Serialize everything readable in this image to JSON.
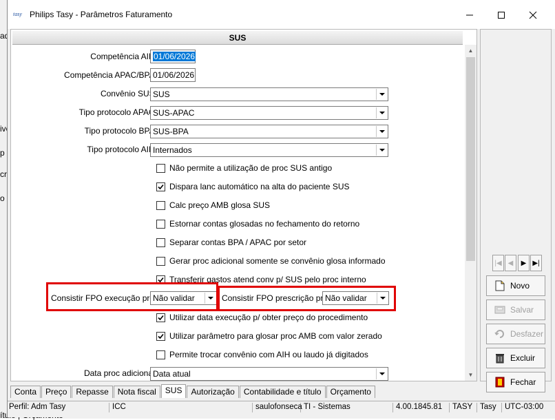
{
  "window": {
    "title": "Philips Tasy - Parâmetros Faturamento"
  },
  "section": {
    "title": "SUS"
  },
  "fields": {
    "competencia_aih": {
      "label": "Competência AIH:",
      "value": "01/06/2026"
    },
    "competencia_apac": {
      "label": "Competência APAC/BPA:",
      "value": "01/06/2026"
    },
    "convenio_sus": {
      "label": "Convênio SUS:",
      "value": "SUS"
    },
    "tipo_apac": {
      "label": "Tipo protocolo APAC:",
      "value": "SUS-APAC"
    },
    "tipo_bpa": {
      "label": "Tipo protocolo BPA:",
      "value": "SUS-BPA"
    },
    "tipo_aih": {
      "label": "Tipo protocolo AIH:",
      "value": "Internados"
    },
    "fpo_exec": {
      "label": "Consistir FPO execução proc:",
      "value": "Não validar"
    },
    "fpo_presc": {
      "label": "Consistir FPO prescrição proc:",
      "value": "Não validar"
    },
    "data_proc": {
      "label": "Data proc adicional:",
      "value": "Data atual"
    }
  },
  "checkboxes": [
    {
      "label": "Não permite a utilização de proc SUS antigo",
      "checked": false
    },
    {
      "label": "Dispara lanc automático na alta do paciente SUS",
      "checked": true
    },
    {
      "label": "Calc preço AMB glosa SUS",
      "checked": false
    },
    {
      "label": "Estornar contas glosadas no fechamento do retorno",
      "checked": false
    },
    {
      "label": "Separar contas BPA / APAC por setor",
      "checked": false
    },
    {
      "label": "Gerar proc adicional somente se convênio glosa informado",
      "checked": false
    },
    {
      "label": "Transferir gastos atend conv p/ SUS pelo proc interno",
      "checked": true
    },
    {
      "label": "Utilizar data execução p/ obter preço do procedimento",
      "checked": true
    },
    {
      "label": "Utilizar parâmetro para glosar proc  AMB com valor zerado",
      "checked": true
    },
    {
      "label": "Permite trocar convênio com AIH ou laudo já digitados",
      "checked": false
    }
  ],
  "actions": {
    "novo": "Novo",
    "salvar": "Salvar",
    "desfazer": "Desfazer",
    "excluir": "Excluir",
    "fechar": "Fechar"
  },
  "tabs": [
    "Conta",
    "Preço",
    "Repasse",
    "Nota fiscal",
    "SUS",
    "Autorização",
    "Contabilidade e título",
    "Orçamento"
  ],
  "active_tab": "SUS",
  "status": {
    "perfil": "Perfil: Adm Tasy",
    "estab": "ICC",
    "user": "saulofonseca",
    "setor": "TI - Sistemas",
    "version": "4.00.1845.81",
    "db": "TASY",
    "schema": "Tasy",
    "tz": "UTC-03:00"
  },
  "behind": {
    "labels": [
      "ad",
      "ivé",
      "p",
      "cr",
      "o"
    ],
    "bottom": "ítulo | Orçamento"
  }
}
